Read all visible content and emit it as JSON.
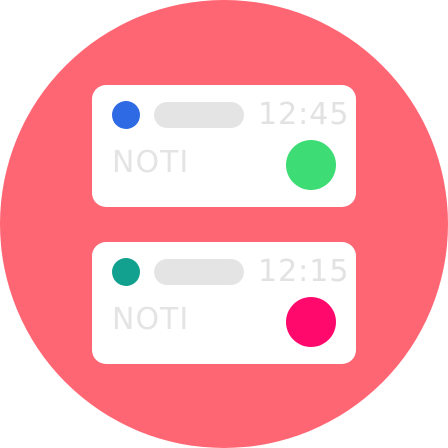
{
  "colors": {
    "background": "#ff6673",
    "card": "#ffffff",
    "placeholder": "#e4e4e4"
  },
  "cards": [
    {
      "time": "12:45",
      "label": "NOTI",
      "dot_color": "#2f6ae5",
      "badge_color": "#3ddc74"
    },
    {
      "time": "12:15",
      "label": "NOTI",
      "dot_color": "#12a08f",
      "badge_color": "#ff0a6c"
    }
  ]
}
